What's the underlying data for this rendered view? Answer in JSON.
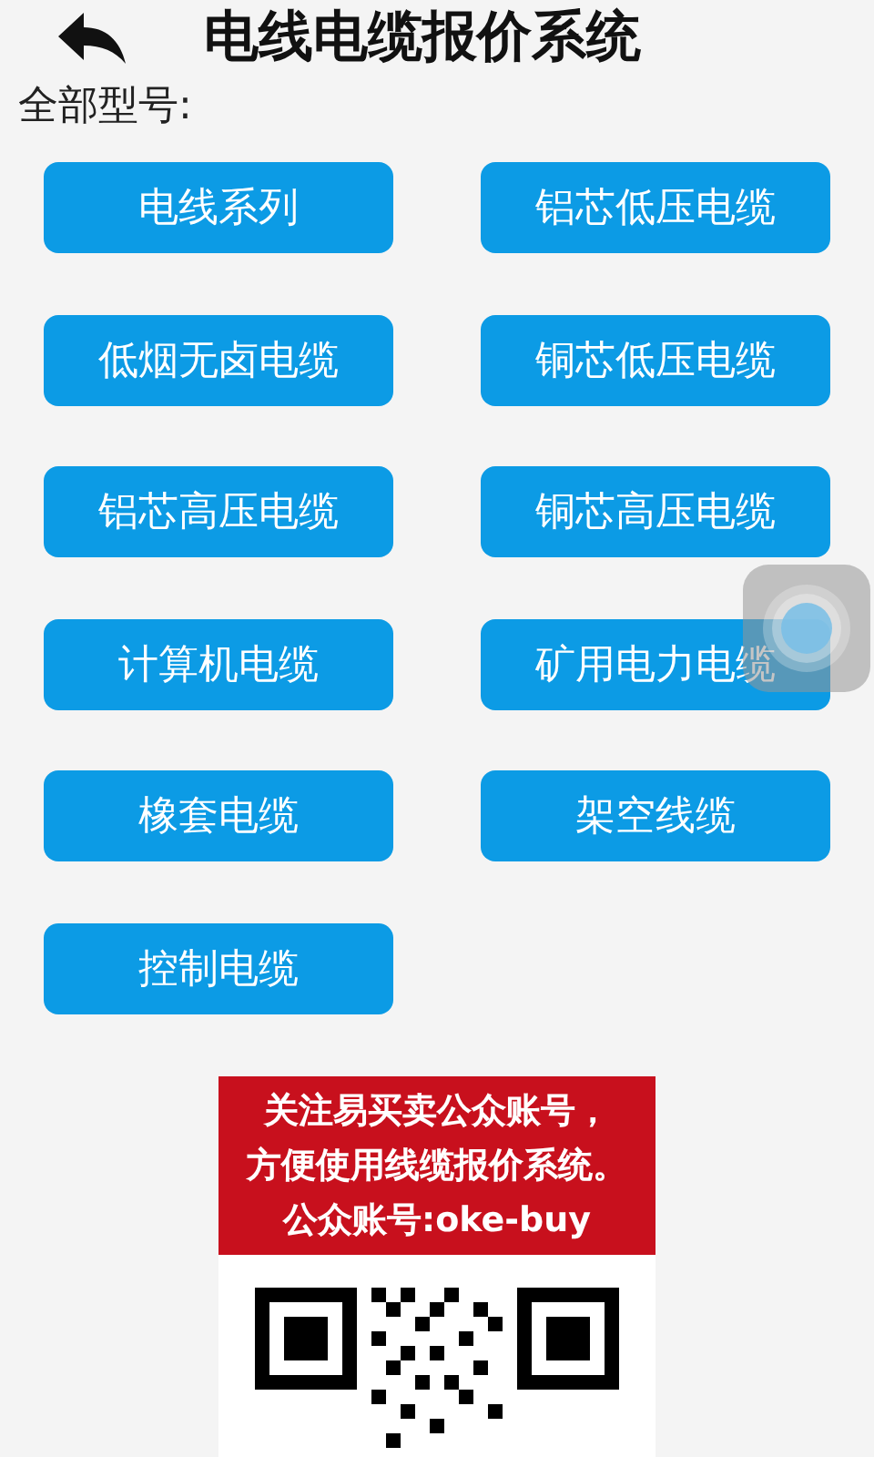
{
  "header": {
    "title": "电线电缆报价系统"
  },
  "section_label": "全部型号:",
  "categories": [
    {
      "label": "电线系列"
    },
    {
      "label": "铝芯低压电缆"
    },
    {
      "label": "低烟无卤电缆"
    },
    {
      "label": "铜芯低压电缆"
    },
    {
      "label": "铝芯高压电缆"
    },
    {
      "label": "铜芯高压电缆"
    },
    {
      "label": "计算机电缆"
    },
    {
      "label": "矿用电力电缆"
    },
    {
      "label": "橡套电缆"
    },
    {
      "label": "架空线缆"
    },
    {
      "label": "控制电缆"
    }
  ],
  "banner": {
    "lines": [
      "关注易买卖公众账号，",
      "方便使用线缆报价系统。",
      "公众账号:oke-buy"
    ]
  }
}
